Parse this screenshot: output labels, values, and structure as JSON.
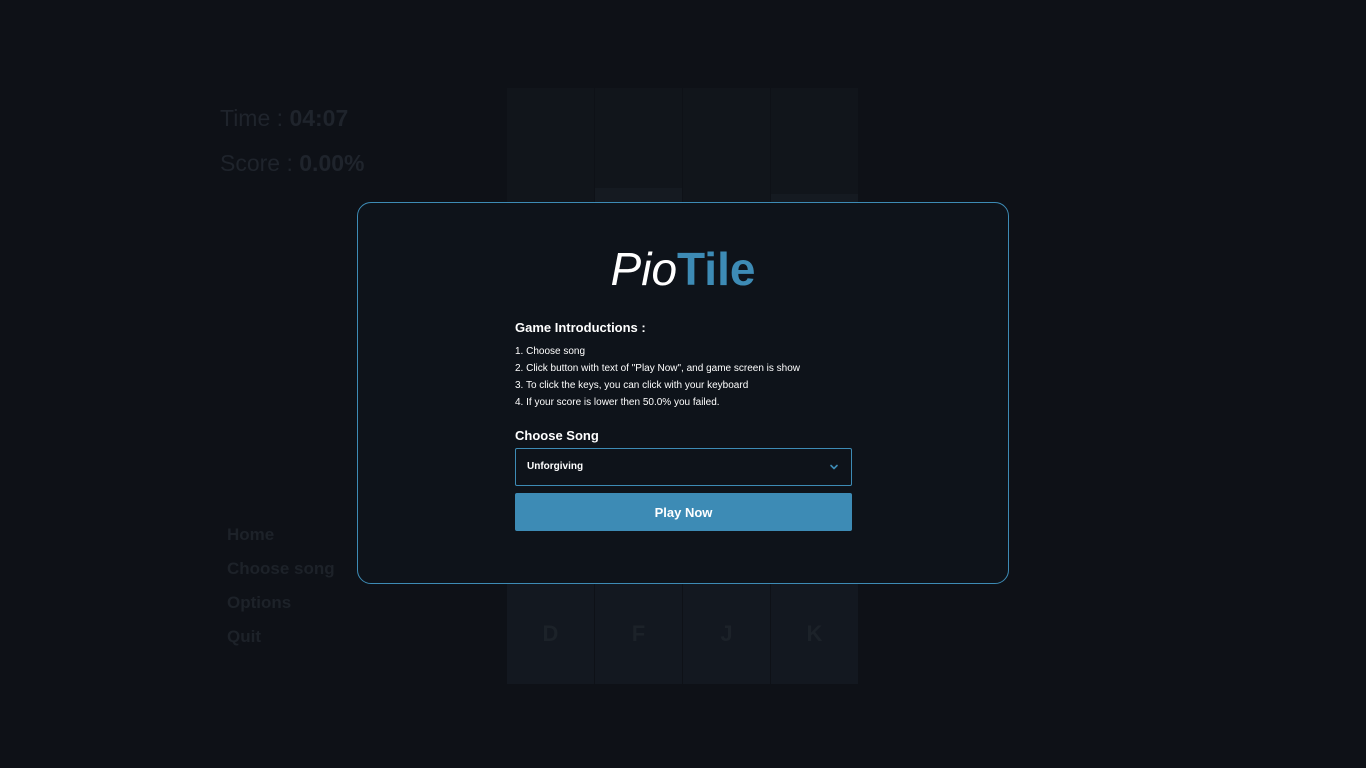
{
  "hud": {
    "time_label": "Time : ",
    "time_value": "04:07",
    "score_label": "Score : ",
    "score_value": "0.00%"
  },
  "lanes": [
    {
      "key": "D"
    },
    {
      "key": "F"
    },
    {
      "key": "J"
    },
    {
      "key": "K"
    }
  ],
  "menu": {
    "items": [
      "Home",
      "Choose song",
      "Options",
      "Quit"
    ]
  },
  "modal": {
    "logo_part1": "Pio",
    "logo_part2": "Tile",
    "intro_title": "Game Introductions :",
    "intro_steps": [
      "1. Choose song",
      "2. Click button with text of \"Play Now\", and game screen is show",
      "3. To click the keys, you can click with your keyboard",
      "4. If your score is lower then 50.0% you failed."
    ],
    "choose_label": "Choose Song",
    "selected_song": "Unforgiving",
    "play_label": "Play Now"
  },
  "colors": {
    "accent": "#3d8bb5",
    "background": "#0e1117",
    "modal_bg": "#0e131a"
  },
  "icons": {
    "select_arrow": "chevron-down-icon"
  }
}
